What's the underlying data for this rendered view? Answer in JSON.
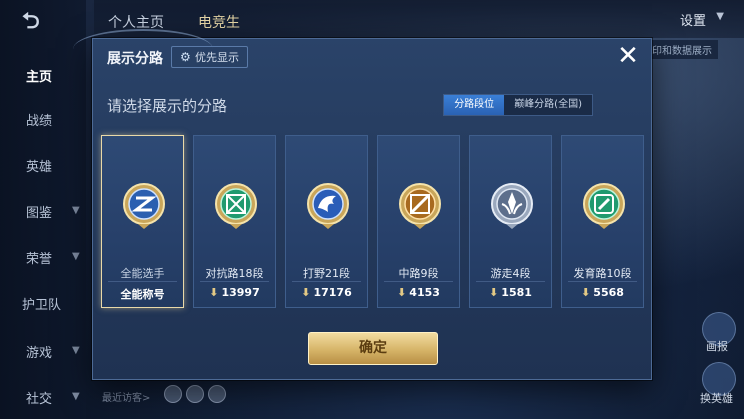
{
  "background": {
    "back_icon": "back-arrow-icon",
    "nav": [
      {
        "label": "主页",
        "active": true
      },
      {
        "label": "战绩",
        "active": false
      },
      {
        "label": "英雄",
        "active": false
      },
      {
        "label": "图鉴",
        "active": false
      },
      {
        "label": "荣誉",
        "active": false
      },
      {
        "label": "护卫队",
        "active": false
      },
      {
        "label": "游戏",
        "active": false
      },
      {
        "label": "社交",
        "active": false
      }
    ],
    "top_tabs": [
      {
        "label": "个人主页",
        "active": false
      },
      {
        "label": "电竞生",
        "active": true
      }
    ],
    "settings_label": "设置",
    "right_tag": "印和数据展示",
    "right_labels": [
      "画报",
      "换英雄"
    ],
    "recent_visitors": "最近访客>"
  },
  "modal": {
    "title": "展示分路",
    "priority_label": "优先显示",
    "close_icon": "close-icon",
    "subtitle": "请选择展示的分路",
    "tabs": [
      {
        "label": "分路段位",
        "active": true
      },
      {
        "label": "巅峰分路(全国)",
        "active": false
      }
    ],
    "cards": [
      {
        "name": "全能选手",
        "extra": "全能称号",
        "score": null,
        "selected": true,
        "emblem": "all-round-emblem-icon"
      },
      {
        "name": "对抗路18段",
        "score": "13997",
        "selected": false,
        "emblem": "clash-lane-emblem-icon"
      },
      {
        "name": "打野21段",
        "score": "17176",
        "selected": false,
        "emblem": "jungle-emblem-icon"
      },
      {
        "name": "中路9段",
        "score": "4153",
        "selected": false,
        "emblem": "mid-lane-emblem-icon"
      },
      {
        "name": "游走4段",
        "score": "1581",
        "selected": false,
        "emblem": "roam-emblem-icon"
      },
      {
        "name": "发育路10段",
        "score": "5568",
        "selected": false,
        "emblem": "farm-lane-emblem-icon"
      }
    ],
    "confirm_label": "确定"
  },
  "colors": {
    "accent_gold": "#d6b468",
    "tab_active_blue": "#2a62b4",
    "modal_bg": "#24395b"
  }
}
